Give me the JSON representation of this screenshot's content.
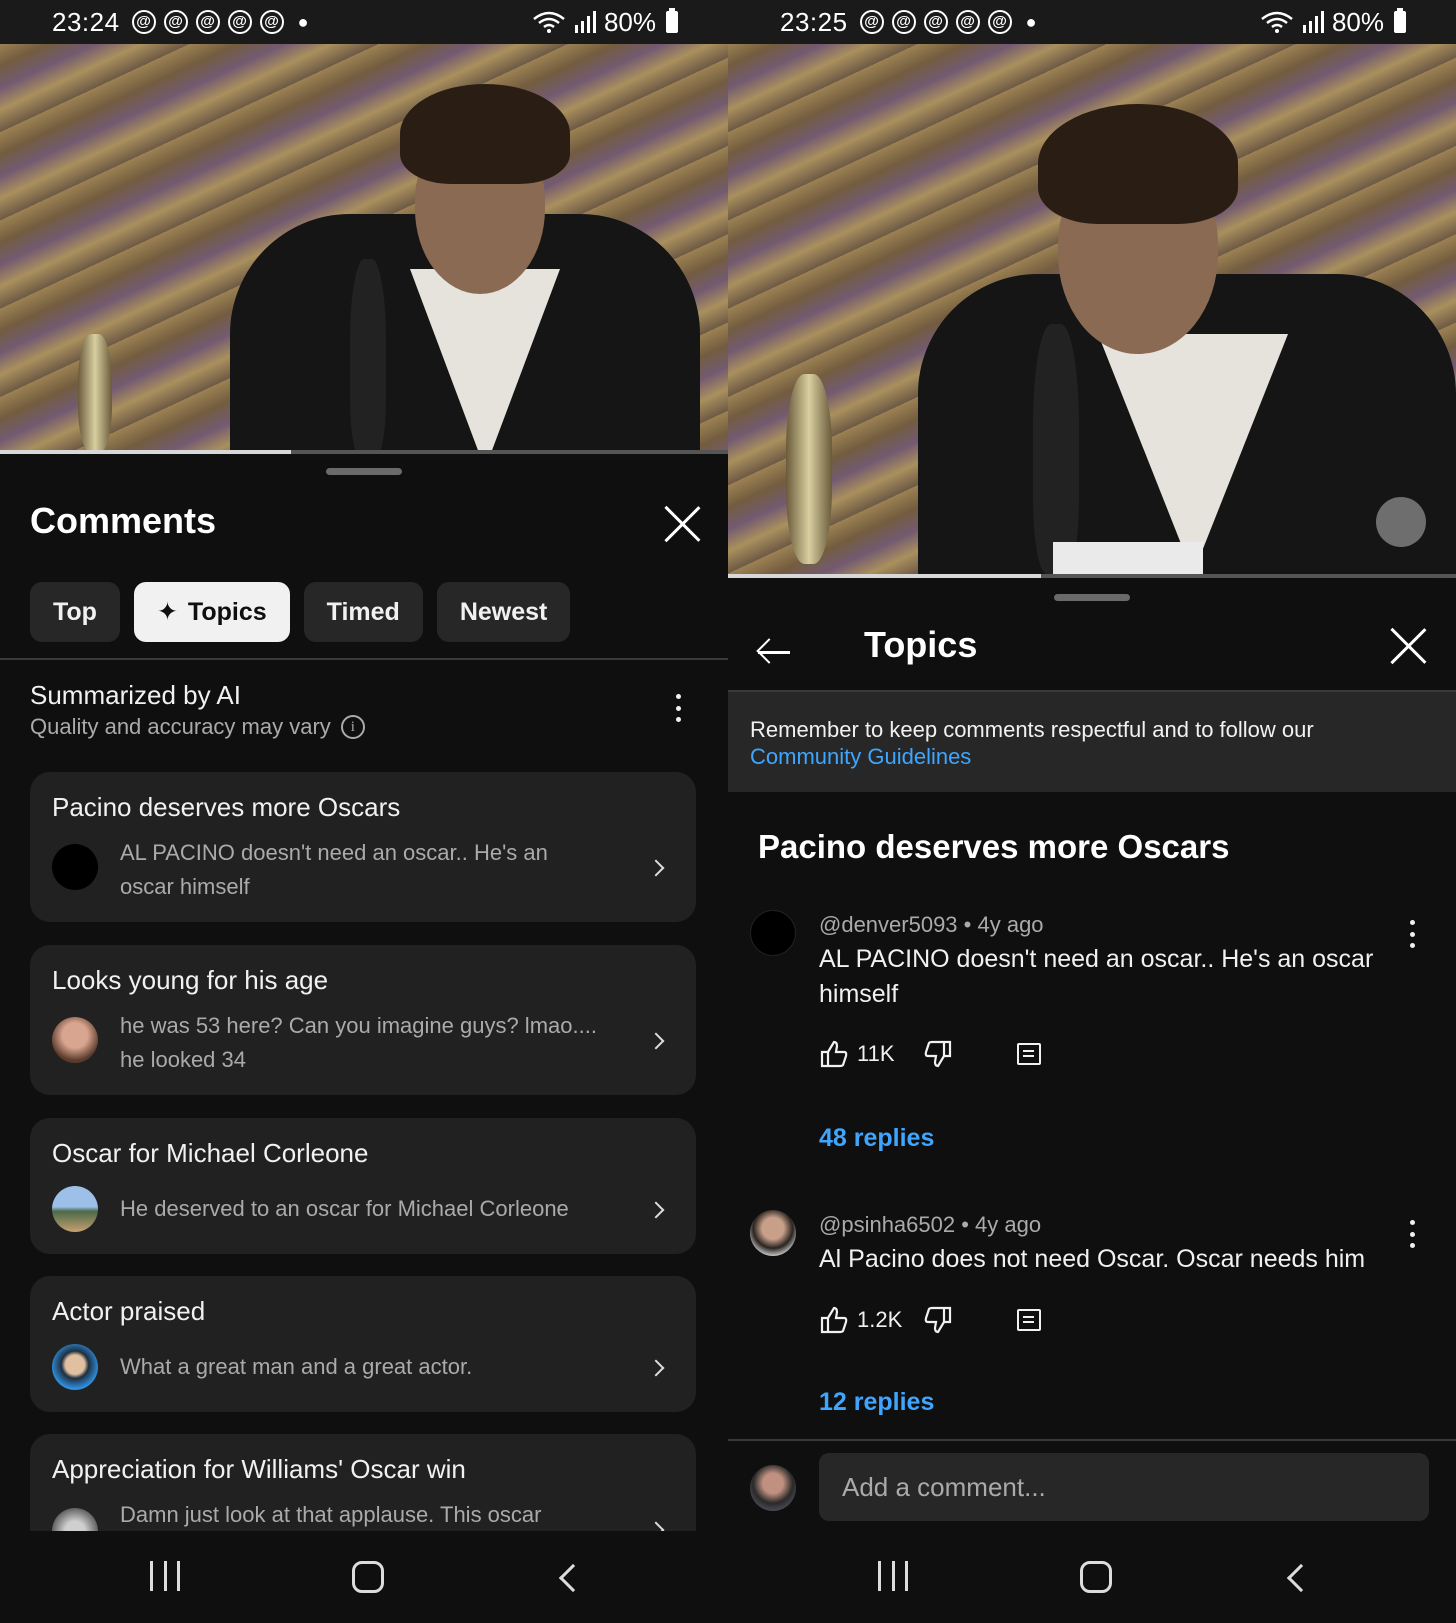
{
  "left": {
    "status": {
      "time": "23:24",
      "battery": "80%",
      "app_icon": "threads-icon",
      "app_icon_count": 5
    },
    "video": {
      "progress": 0.4
    },
    "sheet": {
      "title": "Comments",
      "chips": [
        {
          "label": "Top",
          "active": false
        },
        {
          "label": "Topics",
          "active": true,
          "icon": "sparkle-icon"
        },
        {
          "label": "Timed",
          "active": false
        },
        {
          "label": "Newest",
          "active": false
        }
      ],
      "ai_title": "Summarized by AI",
      "ai_subtitle": "Quality and accuracy may vary",
      "topics": [
        {
          "title": "Pacino deserves more Oscars",
          "snippet": "AL PACINO doesn't need an oscar.. He's an oscar himself",
          "avatar_color": "#000000"
        },
        {
          "title": "Looks young for his age",
          "snippet": "he was 53 here? Can you imagine guys? lmao.... he looked 34",
          "avatar_color": "#b07a6a"
        },
        {
          "title": "Oscar for Michael Corleone",
          "snippet": "He deserved to an oscar for Michael Corleone",
          "avatar_color": "#7aa0c8"
        },
        {
          "title": "Actor praised",
          "snippet": "What a great man and a great actor.",
          "avatar_color": "#2f7fd0"
        },
        {
          "title": "Appreciation for Williams' Oscar win",
          "snippet": "Damn just look at that applause. This oscar",
          "avatar_color": "#777777"
        }
      ]
    }
  },
  "right": {
    "status": {
      "time": "23:25",
      "battery": "80%",
      "app_icon": "threads-icon",
      "app_icon_count": 5
    },
    "video": {
      "progress": 0.43
    },
    "sheet": {
      "title": "Topics",
      "notice_text": "Remember to keep comments respectful and to follow our",
      "notice_link": "Community Guidelines",
      "topic_heading": "Pacino deserves more Oscars",
      "comments": [
        {
          "handle": "@denver5093",
          "age": "4y ago",
          "text": "AL PACINO doesn't need an oscar.. He's an oscar himself",
          "likes": "11K",
          "replies": "48 replies",
          "avatar_color": "#000000"
        },
        {
          "handle": "@psinha6502",
          "age": "4y ago",
          "text": "Al Pacino does not need Oscar. Oscar needs him",
          "likes": "1.2K",
          "replies": "12 replies",
          "avatar_color": "#7a6656"
        }
      ],
      "add_comment_placeholder": "Add a comment..."
    }
  }
}
